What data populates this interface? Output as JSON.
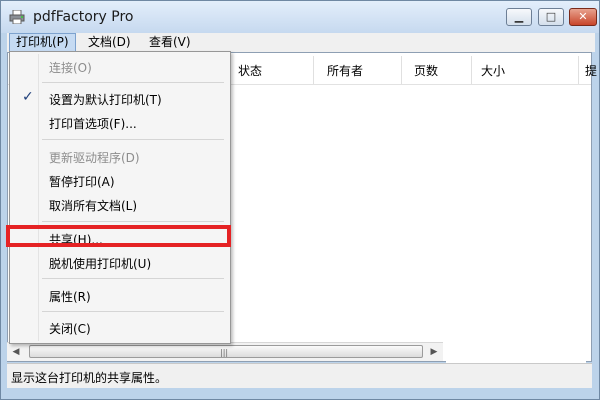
{
  "window": {
    "title": "pdfFactory Pro"
  },
  "menubar": {
    "items": [
      {
        "label": "打印机(P)"
      },
      {
        "label": "文档(D)"
      },
      {
        "label": "查看(V)"
      }
    ]
  },
  "table": {
    "columns": [
      "状态",
      "所有者",
      "页数",
      "大小",
      "提"
    ]
  },
  "printer_menu": {
    "items": [
      {
        "label": "连接(O)",
        "enabled": false
      },
      {
        "label": "设置为默认打印机(T)",
        "checked": true
      },
      {
        "label": "打印首选项(F)..."
      },
      {
        "label": "更新驱动程序(D)",
        "enabled": false
      },
      {
        "label": "暂停打印(A)"
      },
      {
        "label": "取消所有文档(L)"
      },
      {
        "label": "共享(H)...",
        "highlighted": true
      },
      {
        "label": "脱机使用打印机(U)"
      },
      {
        "label": "属性(R)"
      },
      {
        "label": "关闭(C)"
      }
    ],
    "check_mark": "✓"
  },
  "status": {
    "text": "显示这台打印机的共享属性。"
  },
  "colors": {
    "highlight_box": "#e52224",
    "titlebar": "#c6d9ef"
  }
}
